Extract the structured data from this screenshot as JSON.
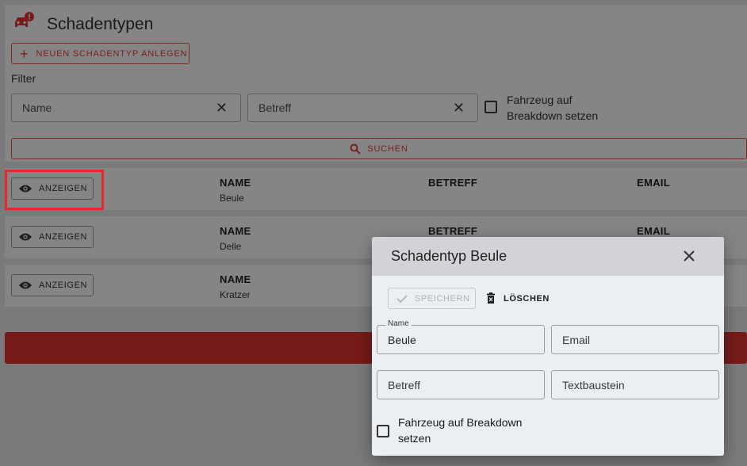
{
  "page": {
    "title": "Schadentypen",
    "new_button": "NEUEN SCHADENTYP ANLEGEN",
    "filter_label": "Filter",
    "filter_name_placeholder": "Name",
    "filter_betreff_placeholder": "Betreff",
    "filter_breakdown_label": "Fahrzeug auf Breakdown setzen",
    "search_button": "SUCHEN"
  },
  "list": {
    "show_label": "ANZEIGEN",
    "headers": {
      "name": "NAME",
      "betreff": "BETREFF",
      "email": "EMAIL"
    },
    "rows": [
      {
        "name": "Beule"
      },
      {
        "name": "Delle"
      },
      {
        "name": "Kratzer"
      }
    ]
  },
  "dialog": {
    "title": "Schadentyp Beule",
    "save_label": "SPEICHERN",
    "delete_label": "LÖSCHEN",
    "name_label": "Name",
    "name_value": "Beule",
    "email_placeholder": "Email",
    "betreff_placeholder": "Betreff",
    "textbaustein_placeholder": "Textbaustein",
    "breakdown_label": "Fahrzeug auf Breakdown setzen"
  },
  "colors": {
    "accent_red": "#d32f2f",
    "highlight": "#e8262b"
  },
  "icons": [
    "car-alert-icon",
    "plus-icon",
    "close-icon",
    "search-icon",
    "eye-icon",
    "check-icon",
    "trash-icon"
  ]
}
